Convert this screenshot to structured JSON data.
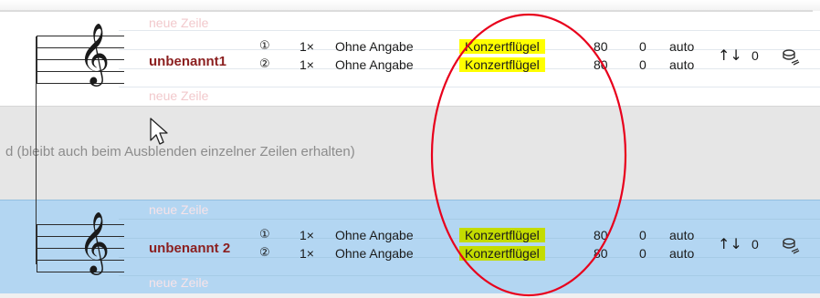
{
  "tracks": [
    {
      "name": "unbenannt1",
      "hint_above": "neue Zeile",
      "hint_below": "neue Zeile",
      "rows": [
        {
          "index": "①",
          "multiplier": "1×",
          "instrument": "Ohne Angabe",
          "sound": "Konzertflügel",
          "v1": "80",
          "v2": "0",
          "v3": "auto"
        },
        {
          "index": "②",
          "multiplier": "1×",
          "instrument": "Ohne Angabe",
          "sound": "Konzertflügel",
          "v1": "80",
          "v2": "0",
          "v3": "auto"
        }
      ],
      "transpose_icon": "↑↓",
      "transpose_value": "0"
    },
    {
      "name": "unbenannt 2",
      "hint_above": "neue Zeile",
      "hint_below": "neue Zeile",
      "rows": [
        {
          "index": "①",
          "multiplier": "1×",
          "instrument": "Ohne Angabe",
          "sound": "Konzertflügel",
          "v1": "80",
          "v2": "0",
          "v3": "auto"
        },
        {
          "index": "②",
          "multiplier": "1×",
          "instrument": "Ohne Angabe",
          "sound": "Konzertflügel",
          "v1": "80",
          "v2": "0",
          "v3": "auto"
        }
      ],
      "transpose_icon": "↑↓",
      "transpose_value": "0"
    }
  ],
  "group_separator_text": "d (bleibt auch beim Ausblenden einzelner Zeilen erhalten)",
  "clef_glyph": "𝄞",
  "icons": [
    "treble-clef-icon",
    "transpose-arrows-icon",
    "layers-icon",
    "mouse-cursor-icon"
  ],
  "colors": {
    "track_name": "#8b1f1f",
    "highlight": "#ffff00",
    "highlight_selected": "#c4dc00",
    "selected_row": "#b3d6f2",
    "annotation_ellipse": "#e8001c"
  }
}
